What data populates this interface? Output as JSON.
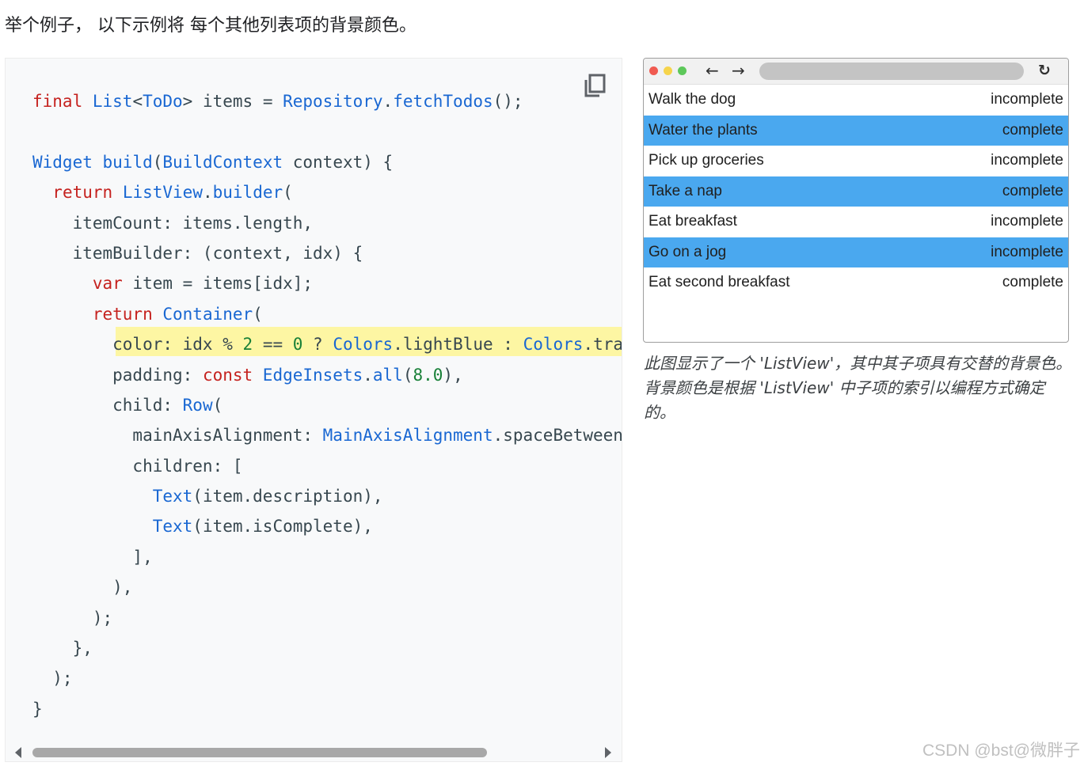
{
  "intro": "举个例子， 以下示例将 每个其他列表项的背景颜色。",
  "code": {
    "lines": [
      [
        {
          "t": "final ",
          "c": "kw"
        },
        {
          "t": "List",
          "c": "ty"
        },
        {
          "t": "<",
          "c": "pl"
        },
        {
          "t": "ToDo",
          "c": "ty"
        },
        {
          "t": "> items = ",
          "c": "pl"
        },
        {
          "t": "Repository",
          "c": "ty"
        },
        {
          "t": ".",
          "c": "pl"
        },
        {
          "t": "fetchTodos",
          "c": "fn"
        },
        {
          "t": "();",
          "c": "pl"
        }
      ],
      [],
      [
        {
          "t": "Widget ",
          "c": "ty"
        },
        {
          "t": "build",
          "c": "fn"
        },
        {
          "t": "(",
          "c": "pl"
        },
        {
          "t": "BuildContext",
          "c": "ty"
        },
        {
          "t": " context) {",
          "c": "pl"
        }
      ],
      [
        {
          "t": "  ",
          "c": "pl"
        },
        {
          "t": "return ",
          "c": "kw"
        },
        {
          "t": "ListView",
          "c": "ty"
        },
        {
          "t": ".",
          "c": "pl"
        },
        {
          "t": "builder",
          "c": "fn"
        },
        {
          "t": "(",
          "c": "pl"
        }
      ],
      [
        {
          "t": "    itemCount: items.length,",
          "c": "pl"
        }
      ],
      [
        {
          "t": "    itemBuilder: (context, idx) {",
          "c": "pl"
        }
      ],
      [
        {
          "t": "      ",
          "c": "pl"
        },
        {
          "t": "var ",
          "c": "kw"
        },
        {
          "t": "item = items[idx];",
          "c": "pl"
        }
      ],
      [
        {
          "t": "      ",
          "c": "pl"
        },
        {
          "t": "return ",
          "c": "kw"
        },
        {
          "t": "Container",
          "c": "ty"
        },
        {
          "t": "(",
          "c": "pl"
        }
      ],
      [
        {
          "t": "        color: idx % ",
          "c": "pl"
        },
        {
          "t": "2",
          "c": "nm"
        },
        {
          "t": " == ",
          "c": "pl"
        },
        {
          "t": "0",
          "c": "nm"
        },
        {
          "t": " ? ",
          "c": "pl"
        },
        {
          "t": "Colors",
          "c": "ty"
        },
        {
          "t": ".lightBlue : ",
          "c": "pl"
        },
        {
          "t": "Colors",
          "c": "ty"
        },
        {
          "t": ".transparent,",
          "c": "pl"
        }
      ],
      [
        {
          "t": "        padding: ",
          "c": "pl"
        },
        {
          "t": "const ",
          "c": "kw"
        },
        {
          "t": "EdgeInsets",
          "c": "ty"
        },
        {
          "t": ".",
          "c": "pl"
        },
        {
          "t": "all",
          "c": "fn"
        },
        {
          "t": "(",
          "c": "pl"
        },
        {
          "t": "8.0",
          "c": "nm"
        },
        {
          "t": "),",
          "c": "pl"
        }
      ],
      [
        {
          "t": "        child: ",
          "c": "pl"
        },
        {
          "t": "Row",
          "c": "ty"
        },
        {
          "t": "(",
          "c": "pl"
        }
      ],
      [
        {
          "t": "          mainAxisAlignment: ",
          "c": "pl"
        },
        {
          "t": "MainAxisAlignment",
          "c": "ty"
        },
        {
          "t": ".spaceBetween,",
          "c": "pl"
        }
      ],
      [
        {
          "t": "          children: [",
          "c": "pl"
        }
      ],
      [
        {
          "t": "            ",
          "c": "pl"
        },
        {
          "t": "Text",
          "c": "ty"
        },
        {
          "t": "(item.description),",
          "c": "pl"
        }
      ],
      [
        {
          "t": "            ",
          "c": "pl"
        },
        {
          "t": "Text",
          "c": "ty"
        },
        {
          "t": "(item.isComplete),",
          "c": "pl"
        }
      ],
      [
        {
          "t": "          ],",
          "c": "pl"
        }
      ],
      [
        {
          "t": "        ),",
          "c": "pl"
        }
      ],
      [
        {
          "t": "      );",
          "c": "pl"
        }
      ],
      [
        {
          "t": "    },",
          "c": "pl"
        }
      ],
      [
        {
          "t": "  );",
          "c": "pl"
        }
      ],
      [
        {
          "t": "}",
          "c": "pl"
        }
      ]
    ],
    "highlight_line": 8
  },
  "colors": {
    "highlight": "#fdf6a3",
    "row_blue": "#4aa8ef",
    "dot_red": "#f05a50",
    "dot_yellow": "#f6d44b",
    "dot_green": "#5dc85a"
  },
  "browser": {
    "icons": {
      "back": "arrow-left-icon",
      "forward": "arrow-right-icon",
      "reload": "reload-icon"
    },
    "items": [
      {
        "description": "Walk the dog",
        "status": "incomplete",
        "highlighted": false
      },
      {
        "description": "Water the plants",
        "status": "complete",
        "highlighted": true
      },
      {
        "description": "Pick up groceries",
        "status": "incomplete",
        "highlighted": false
      },
      {
        "description": "Take a nap",
        "status": "complete",
        "highlighted": true
      },
      {
        "description": "Eat breakfast",
        "status": "incomplete",
        "highlighted": false
      },
      {
        "description": "Go on a jog",
        "status": "incomplete",
        "highlighted": true
      },
      {
        "description": "Eat second breakfast",
        "status": "complete",
        "highlighted": false
      }
    ]
  },
  "caption": "此图显示了一个 'ListView'，其中其子项具有交替的背景色。背景颜色是根据 'ListView' 中子项的索引以编程方式确定的。",
  "watermark": "CSDN @bst@微胖子"
}
